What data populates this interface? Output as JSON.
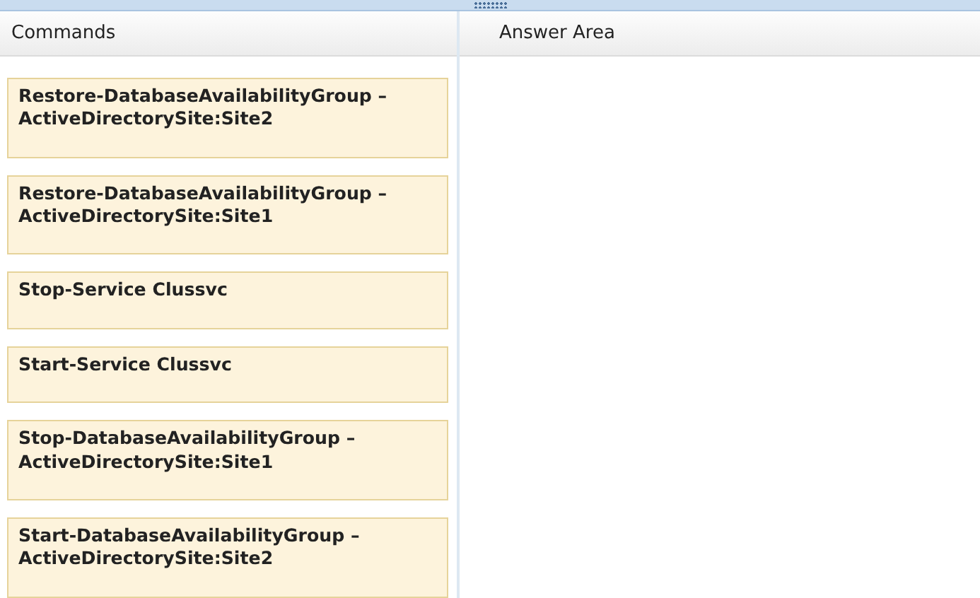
{
  "panels": [
    {
      "title": "Commands"
    },
    {
      "title": "Answer Area"
    }
  ],
  "commands": [
    {
      "text": "Restore-DatabaseAvailabilityGroup –\nActiveDirectorySite:Site2"
    },
    {
      "text": "Restore-DatabaseAvailabilityGroup –\nActiveDirectorySite:Site1"
    },
    {
      "text": "Stop-Service Clussvc"
    },
    {
      "text": "Start-Service Clussvc"
    },
    {
      "text": "Stop-DatabaseAvailabilityGroup –\nActiveDirectorySite:Site1"
    },
    {
      "text": "Start-DatabaseAvailabilityGroup –\nActiveDirectorySite:Site2"
    }
  ]
}
